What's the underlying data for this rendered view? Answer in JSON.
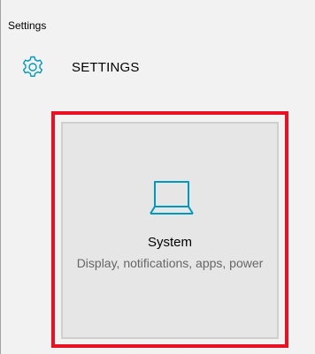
{
  "window": {
    "title": "Settings"
  },
  "header": {
    "icon": "gear-icon",
    "title": "SETTINGS"
  },
  "tiles": [
    {
      "icon": "laptop-icon",
      "title": "System",
      "description": "Display, notifications, apps, power",
      "highlighted": true
    }
  ],
  "colors": {
    "accent": "#0099bc",
    "highlight_border": "#e81123",
    "tile_background": "#e6e6e6",
    "window_background": "#f2f2f2",
    "secondary_text": "#666666"
  }
}
